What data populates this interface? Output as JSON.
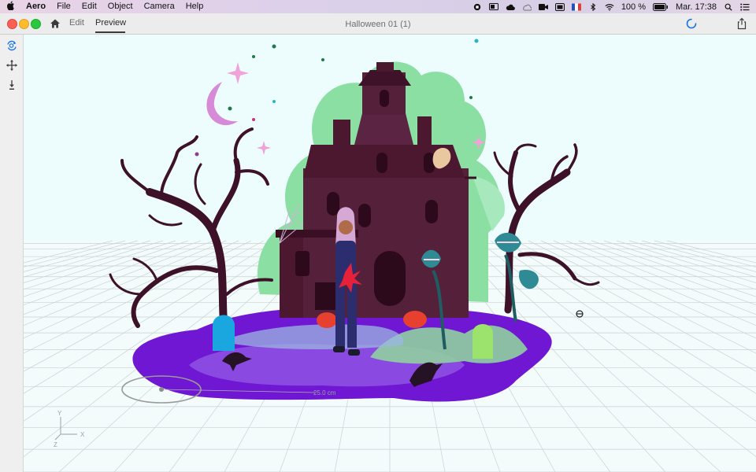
{
  "menubar": {
    "app_name": "Aero",
    "items": [
      "File",
      "Edit",
      "Object",
      "Camera",
      "Help"
    ],
    "battery": "100 %",
    "clock": "Mar. 17:38"
  },
  "window": {
    "title": "Halloween 01 (1)",
    "tabs": {
      "edit": "Edit",
      "preview": "Preview"
    },
    "active_tab": "Preview"
  },
  "toolbar": {
    "tools": [
      "rotate-view-icon",
      "move-icon",
      "place-icon"
    ]
  },
  "viewport": {
    "ground_ring_label": "25.0 cm",
    "axes": {
      "y": "Y",
      "x": "X",
      "z": "Z"
    },
    "background_color": "#eefcfd"
  },
  "colors": {
    "accent": "#1473e6",
    "house": "#4b1830",
    "trees": "#3d1229",
    "ground_purple": "#6f17d2",
    "bush_green": "#8bdfa3"
  }
}
